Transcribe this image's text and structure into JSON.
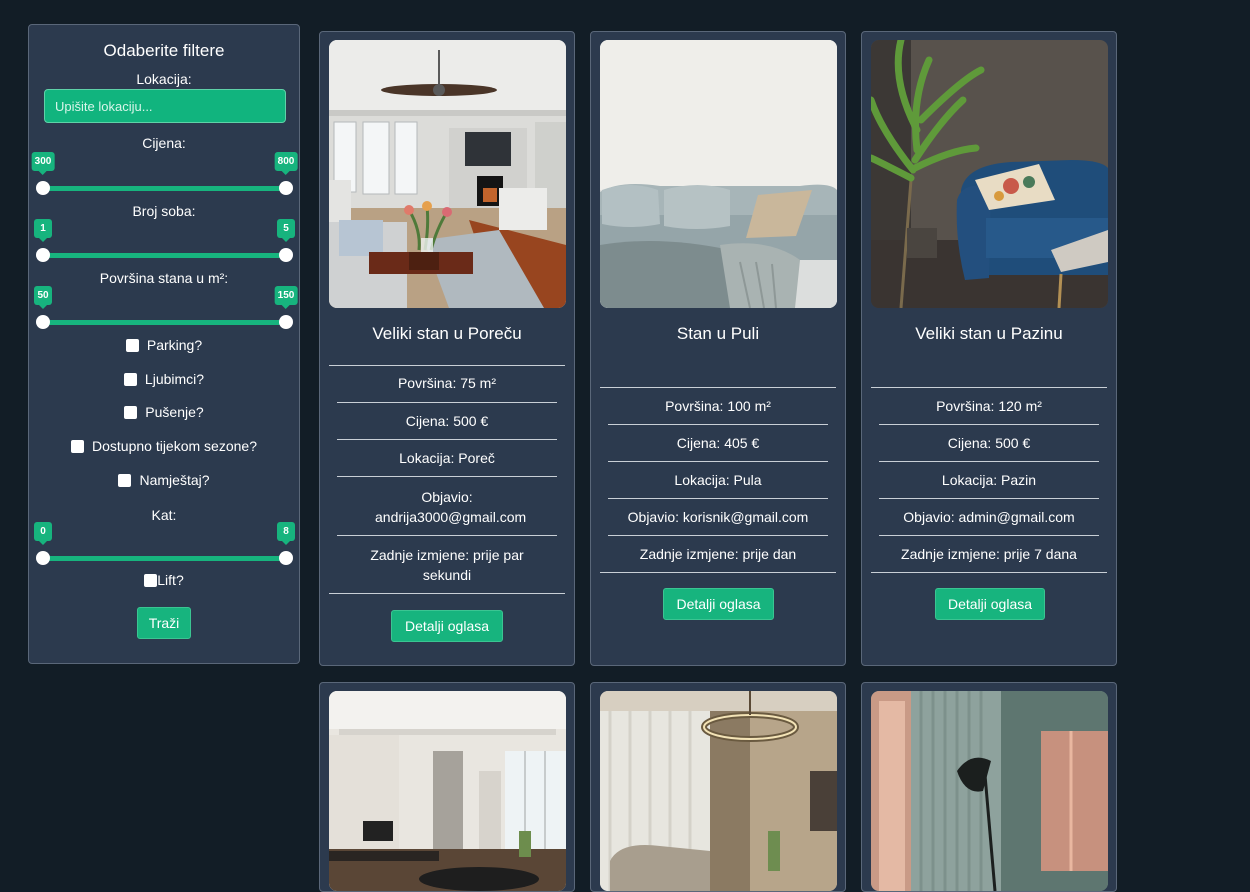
{
  "filters": {
    "title": "Odaberite filtere",
    "location_label": "Lokacija:",
    "location_placeholder": "Upišite lokaciju...",
    "location_value": "",
    "price_label": "Cijena:",
    "price_min": "300",
    "price_max": "800",
    "rooms_label": "Broj soba:",
    "rooms_min": "1",
    "rooms_max": "5",
    "area_label": "Površina stana u m²:",
    "area_min": "50",
    "area_max": "150",
    "parking_label": "Parking?",
    "pets_label": "Ljubimci?",
    "smoking_label": "Pušenje?",
    "season_label": "Dostupno tijekom sezone?",
    "furniture_label": "Namještaj?",
    "floor_label": "Kat:",
    "floor_min": "0",
    "floor_max": "8",
    "lift_label": "Lift?",
    "search_button": "Traži"
  },
  "listings": [
    {
      "title": "Veliki stan u Poreču",
      "area": "Površina: 75 m²",
      "price": "Cijena: 500 €",
      "location": "Lokacija: Poreč",
      "author": "Objavio: andrija3000@gmail.com",
      "modified": "Zadnje izmjene: prije par sekundi",
      "button": "Detalji oglasa"
    },
    {
      "title": "Stan u Puli",
      "area": "Površina: 100 m²",
      "price": "Cijena: 405 €",
      "location": "Lokacija: Pula",
      "author": "Objavio: korisnik@gmail.com",
      "modified": "Zadnje izmjene: prije dan",
      "button": "Detalji oglasa"
    },
    {
      "title": "Veliki stan u Pazinu",
      "area": "Površina: 120 m²",
      "price": "Cijena: 500 €",
      "location": "Lokacija: Pazin",
      "author": "Objavio: admin@gmail.com",
      "modified": "Zadnje izmjene: prije 7 dana",
      "button": "Detalji oglasa"
    }
  ],
  "colors": {
    "background": "#121d26",
    "panel": "#2c3a4e",
    "accent": "#17b47e"
  }
}
